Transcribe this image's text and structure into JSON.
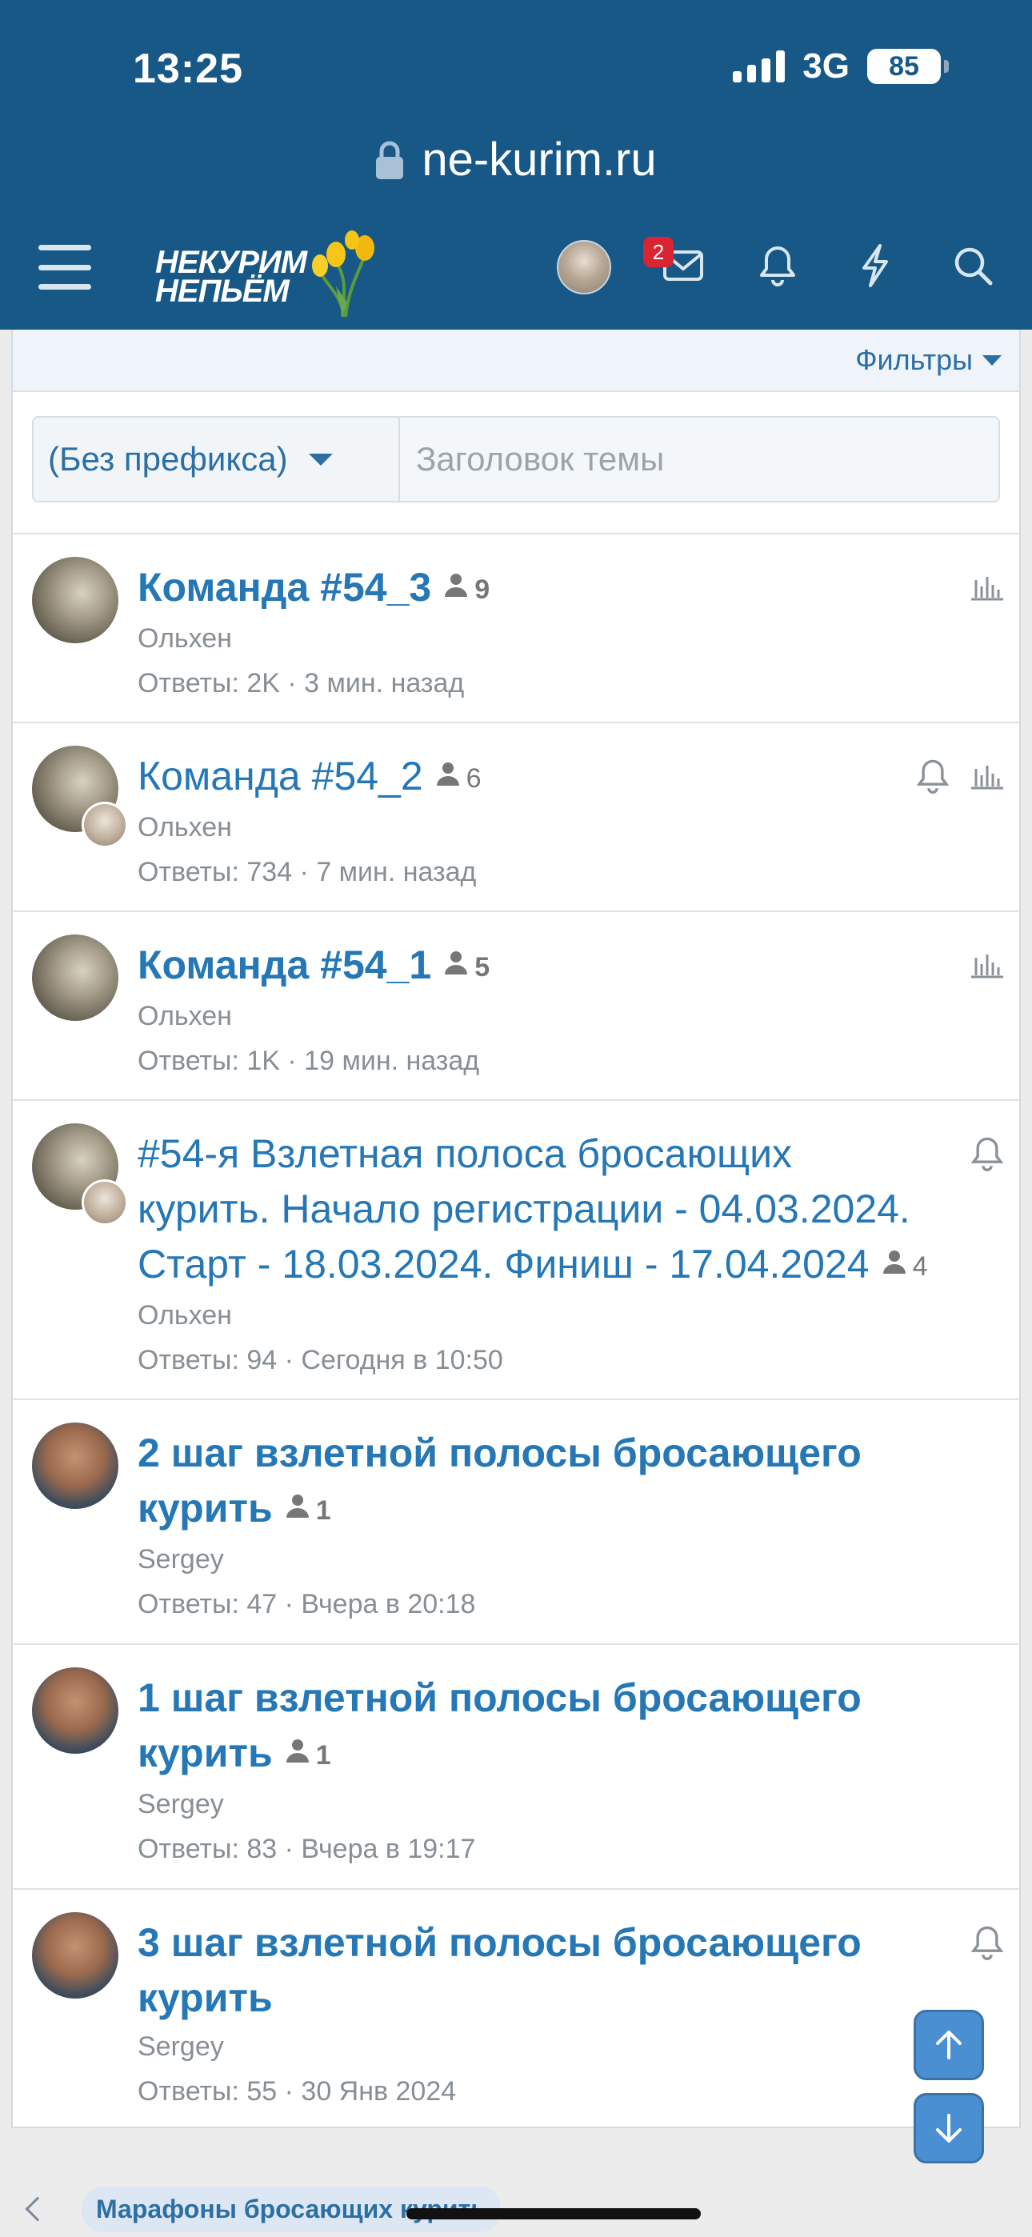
{
  "status": {
    "time": "13:25",
    "network": "3G",
    "battery": "85"
  },
  "browser": {
    "url": "ne-kurim.ru"
  },
  "header": {
    "logo_text_line1": "НЕКУРИМ",
    "logo_text_line2": "НЕПЬЁМ",
    "inbox_badge": "2"
  },
  "filters": {
    "label": "Фильтры"
  },
  "new_thread": {
    "prefix": "(Без префикса)",
    "title_placeholder": "Заголовок темы"
  },
  "threads": [
    {
      "title": "Команда #54_3",
      "bold": true,
      "participants": "9",
      "author": "Ольхен",
      "meta": "Ответы: 2K · 3 мин. назад"
    },
    {
      "title": "Команда #54_2",
      "bold": false,
      "participants": "6",
      "author": "Ольхен",
      "meta": "Ответы: 734 · 7 мин. назад"
    },
    {
      "title": "Команда #54_1",
      "bold": true,
      "participants": "5",
      "author": "Ольхен",
      "meta": "Ответы: 1K · 19 мин. назад"
    },
    {
      "title": "#54-я Взлетная полоса бросающих курить. Начало регистрации - 04.03.2024. Старт - 18.03.2024. Финиш - 17.04.2024",
      "bold": false,
      "participants": "4",
      "author": "Ольхен",
      "meta": "Ответы: 94 · Сегодня в 10:50"
    },
    {
      "title": "2 шаг взлетной полосы бросающего курить",
      "bold": true,
      "participants": "1",
      "author": "Sergey",
      "meta": "Ответы: 47 · Вчера в 20:18"
    },
    {
      "title": "1 шаг взлетной полосы бросающего курить",
      "bold": true,
      "participants": "1",
      "author": "Sergey",
      "meta": "Ответы: 83 · Вчера в 19:17"
    },
    {
      "title": "3 шаг взлетной полосы бросающего курить",
      "bold": true,
      "participants": "",
      "author": "Sergey",
      "meta": "Ответы: 55 · 30 Янв 2024"
    }
  ],
  "breadcrumb": {
    "item": "Марафоны бросающих курить"
  },
  "colors": {
    "header_bg": "#185886",
    "link": "#2577b5",
    "badge": "#d92531"
  }
}
